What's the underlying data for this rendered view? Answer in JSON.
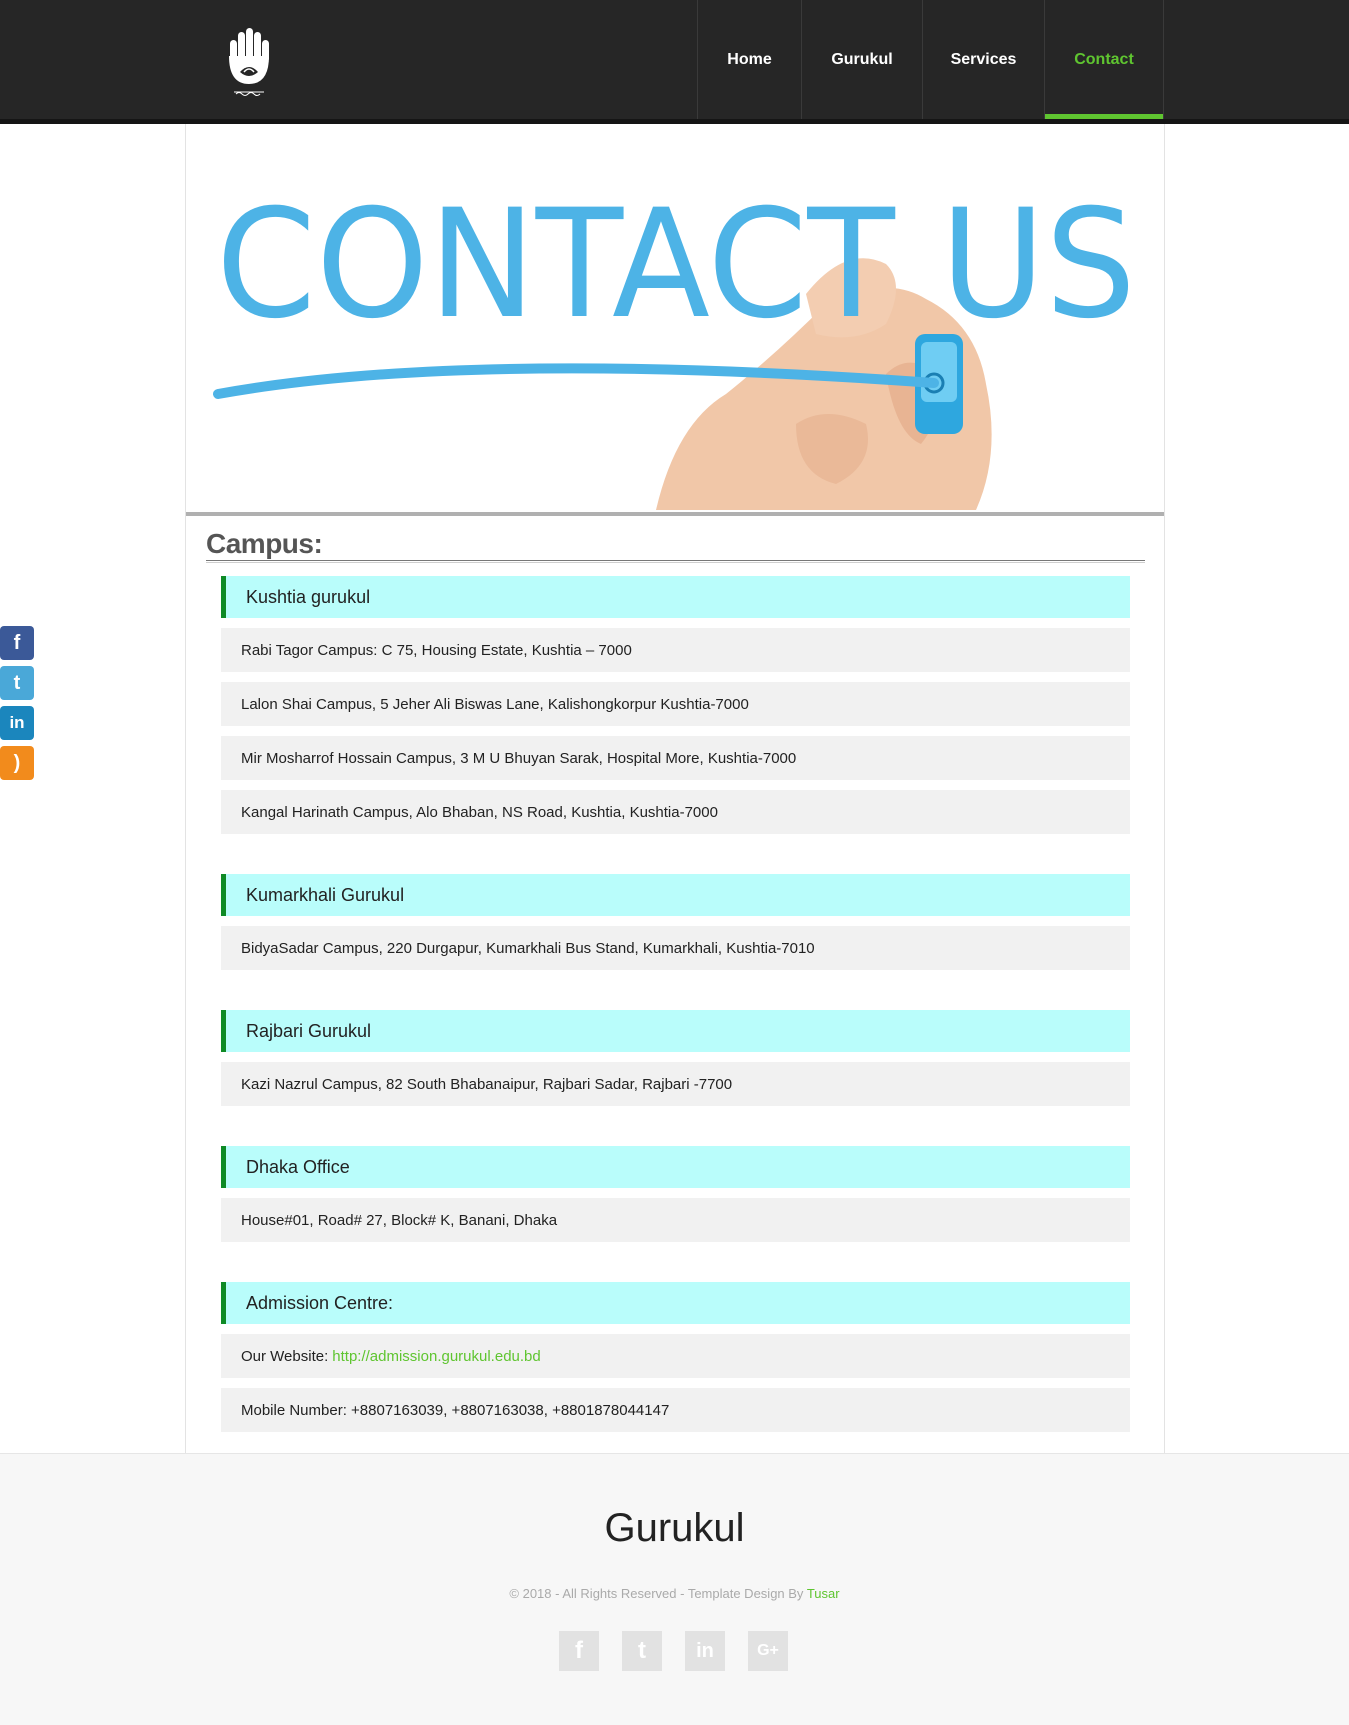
{
  "header": {
    "logo_name": "gurukul-hand-logo",
    "nav": [
      {
        "label": "Home"
      },
      {
        "label": "Gurukul"
      },
      {
        "label": "Services"
      },
      {
        "label": "Contact"
      }
    ],
    "active_color": "#5fc530"
  },
  "hero": {
    "text": "CONTACT US",
    "color": "#4db3e6"
  },
  "campus": {
    "title": "Campus:",
    "groups": [
      {
        "heading": "Kushtia gurukul",
        "rows": [
          "Rabi Tagor Campus: C 75, Housing Estate, Kushtia – 7000",
          "Lalon Shai Campus, 5 Jeher Ali Biswas Lane, Kalishongkorpur Kushtia-7000",
          "Mir Mosharrof Hossain Campus, 3 M U Bhuyan Sarak, Hospital More, Kushtia-7000",
          "Kangal Harinath Campus, Alo Bhaban, NS Road, Kushtia, Kushtia-7000"
        ]
      },
      {
        "heading": "Kumarkhali Gurukul",
        "rows": [
          "BidyaSadar Campus, 220 Durgapur, Kumarkhali Bus Stand, Kumarkhali, Kushtia-7010"
        ]
      },
      {
        "heading": "Rajbari Gurukul",
        "rows": [
          "Kazi Nazrul Campus, 82 South Bhabanaipur, Rajbari Sadar, Rajbari -7700"
        ]
      },
      {
        "heading": "Dhaka Office",
        "rows": [
          "House#01, Road# 27, Block# K, Banani, Dhaka"
        ]
      },
      {
        "heading": "Admission Centre:",
        "website_label": "Our Website:",
        "website_link": "http://admission.gurukul.edu.bd",
        "mobile": "Mobile Number: +8807163039, +8807163038, +8801878044147"
      }
    ]
  },
  "side_social": [
    {
      "icon": "facebook-icon",
      "glyph": "f",
      "color": "#3b5998"
    },
    {
      "icon": "twitter-icon",
      "glyph": "t",
      "color": "#4aa8d8"
    },
    {
      "icon": "linkedin-icon",
      "glyph": "in",
      "color": "#1b86bd"
    },
    {
      "icon": "rss-icon",
      "glyph": ")",
      "color": "#f28b1c"
    }
  ],
  "footer": {
    "title": "Gurukul",
    "copyright": "© 2018 - All Rights Reserved - Template Design By",
    "author": "Tusar",
    "social": [
      {
        "icon": "facebook-icon",
        "glyph": "f"
      },
      {
        "icon": "twitter-icon",
        "glyph": "t"
      },
      {
        "icon": "linkedin-icon",
        "glyph": "in"
      },
      {
        "icon": "googleplus-icon",
        "glyph": "G+"
      }
    ]
  }
}
